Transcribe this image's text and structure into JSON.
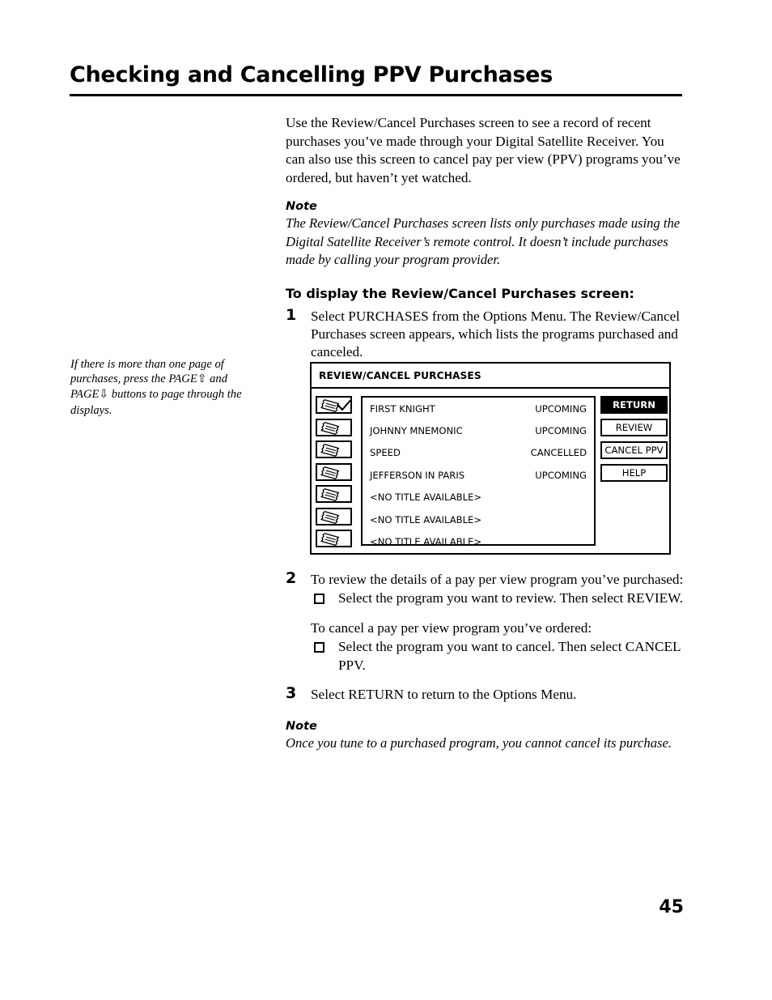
{
  "document": {
    "title": "Checking and Cancelling PPV Purchases",
    "page_number": "45"
  },
  "intro": {
    "paragraph": "Use the Review/Cancel Purchases screen to see a record of recent purchases you’ve made through your Digital Satellite Receiver. You can also use this screen to cancel pay per view (PPV) programs you’ve ordered, but haven’t yet watched."
  },
  "note_top": {
    "heading": "Note",
    "body": "The Review/Cancel Purchases screen lists only purchases made using the Digital Satellite Receiver’s remote control. It doesn’t include purchases made by calling your program provider."
  },
  "procedure": {
    "heading": "To display the Review/Cancel Purchases screen:",
    "step1_num": "1",
    "step1_text": "Select PURCHASES from the Options Menu. The Review/Cancel Purchases screen appears, which lists the programs purchased and canceled.",
    "step2_num": "2",
    "step2_text": "To review the details of a pay per view program you’ve purchased:",
    "step2_bullet": "Select the program you want to review. Then select REVIEW.",
    "step2_text_b": "To cancel a pay per view program you’ve ordered:",
    "step2_bullet_b": "Select the program you want to cancel. Then select CANCEL PPV.",
    "step3_num": "3",
    "step3_text": "Select RETURN to return to the Options Menu."
  },
  "note_bottom": {
    "heading": "Note",
    "body": "Once you tune to a purchased program, you cannot cancel its purchase."
  },
  "margin_note": {
    "line1": "If there is more than one page of",
    "line2_a": "purchases, press the PAGE",
    "arrow_up": "⇧",
    "line2_b": " and",
    "line3_a": "PAGE",
    "arrow_down": "⇩",
    "line3_b": " buttons to page through the",
    "line4": "displays."
  },
  "tv_screen": {
    "header": "REVIEW/CANCEL PURCHASES",
    "rows": [
      {
        "icon": "ticket-icon",
        "checked": true,
        "title": "FIRST KNIGHT",
        "status": "UPCOMING"
      },
      {
        "icon": "ticket-icon",
        "checked": false,
        "title": "JOHNNY MNEMONIC",
        "status": "UPCOMING"
      },
      {
        "icon": "ticket-icon",
        "checked": false,
        "title": "SPEED",
        "status": "CANCELLED"
      },
      {
        "icon": "ticket-icon",
        "checked": false,
        "title": "JEFFERSON IN PARIS",
        "status": "UPCOMING"
      },
      {
        "icon": "ticket-icon",
        "checked": false,
        "title": "<NO TITLE AVAILABLE>",
        "status": ""
      },
      {
        "icon": "ticket-icon",
        "checked": false,
        "title": "<NO TITLE AVAILABLE>",
        "status": ""
      },
      {
        "icon": "ticket-icon",
        "checked": false,
        "title": "<NO TITLE AVAILABLE>",
        "status": ""
      }
    ],
    "buttons": [
      {
        "label": "RETURN",
        "selected": true
      },
      {
        "label": "REVIEW",
        "selected": false
      },
      {
        "label": "CANCEL PPV",
        "selected": false
      },
      {
        "label": "HELP",
        "selected": false
      }
    ]
  },
  "colors": {
    "ink": "#000000",
    "paper": "#ffffff",
    "selected_bg": "#000000",
    "selected_fg": "#ffffff"
  }
}
